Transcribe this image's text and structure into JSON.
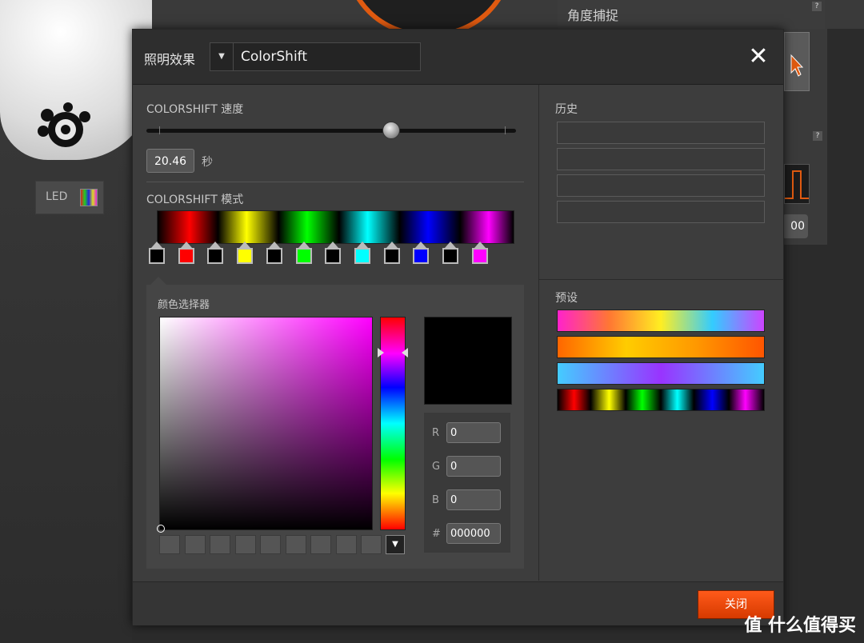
{
  "background_app": {
    "led_label": "LED",
    "angle_snap_label": "角度捕捉",
    "help_mark": "?",
    "value_fragment": "00",
    "watermark": "值 什么值得买"
  },
  "dialog": {
    "title": "照明效果",
    "effect_select": {
      "arrow": "▼",
      "value": "ColorShift"
    },
    "close_glyph": "✕",
    "speed": {
      "label": "COLORSHIFT 速度",
      "value": "20.46",
      "unit": "秒",
      "position": 0.66
    },
    "mode_label": "COLORSHIFT 模式",
    "stops": [
      {
        "color": "#000000"
      },
      {
        "color": "#ff0000"
      },
      {
        "color": "#000000"
      },
      {
        "color": "#ffff00"
      },
      {
        "color": "#000000"
      },
      {
        "color": "#00ff00"
      },
      {
        "color": "#000000"
      },
      {
        "color": "#00ffff"
      },
      {
        "color": "#000000"
      },
      {
        "color": "#0000ff"
      },
      {
        "color": "#000000"
      },
      {
        "color": "#ff00ff"
      }
    ],
    "picker": {
      "label": "颜色选择器",
      "preview_color": "#000000",
      "r_label": "R",
      "r_value": "0",
      "g_label": "G",
      "g_value": "0",
      "b_label": "B",
      "b_value": "0",
      "hex_label": "#",
      "hex_value": "000000",
      "swatch_menu_glyph": "▼"
    },
    "history_label": "历史",
    "presets_label": "预设",
    "footer": {
      "close_label": "关闭"
    }
  }
}
